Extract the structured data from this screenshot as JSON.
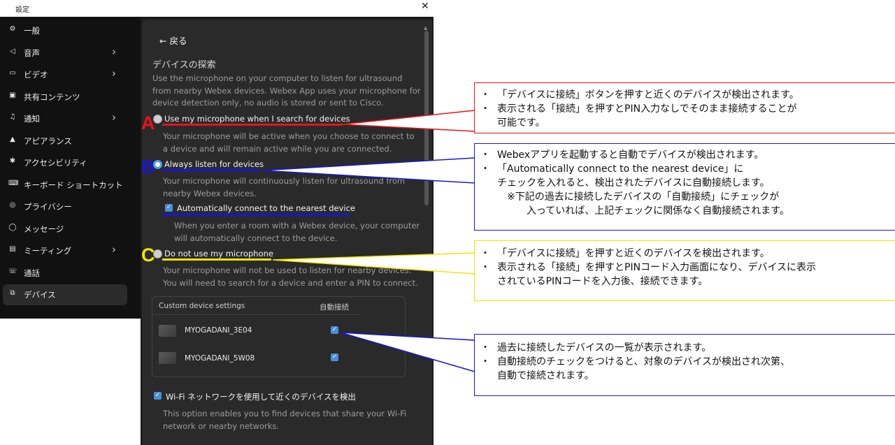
{
  "window": {
    "title": "設定",
    "close_glyph": "✕"
  },
  "sidebar": {
    "items": [
      {
        "label": "一般",
        "icon": "gear-icon",
        "glyph": "⚙",
        "chevron": false,
        "active": false
      },
      {
        "label": "音声",
        "icon": "speaker-icon",
        "glyph": "◁",
        "chevron": true,
        "active": false
      },
      {
        "label": "ビデオ",
        "icon": "video-icon",
        "glyph": "▭",
        "chevron": true,
        "active": false
      },
      {
        "label": "共有コンテンツ",
        "icon": "share-icon",
        "glyph": "▣",
        "chevron": false,
        "active": false
      },
      {
        "label": "通知",
        "icon": "bell-icon",
        "glyph": "♫",
        "chevron": true,
        "active": false
      },
      {
        "label": "アピアランス",
        "icon": "brush-icon",
        "glyph": "▲",
        "chevron": false,
        "active": false
      },
      {
        "label": "アクセシビリティ",
        "icon": "accessibility-icon",
        "glyph": "✱",
        "chevron": false,
        "active": false
      },
      {
        "label": "キーボード ショートカット",
        "icon": "keyboard-icon",
        "glyph": "⌨",
        "chevron": false,
        "active": false
      },
      {
        "label": "プライバシー",
        "icon": "privacy-icon",
        "glyph": "◎",
        "chevron": false,
        "active": false
      },
      {
        "label": "メッセージ",
        "icon": "message-icon",
        "glyph": "◯",
        "chevron": false,
        "active": false
      },
      {
        "label": "ミーティング",
        "icon": "calendar-icon",
        "glyph": "▤",
        "chevron": true,
        "active": false
      },
      {
        "label": "通話",
        "icon": "call-icon",
        "glyph": "☏",
        "chevron": false,
        "active": false
      },
      {
        "label": "デバイス",
        "icon": "device-icon",
        "glyph": "⧉",
        "chevron": false,
        "active": true
      }
    ]
  },
  "main": {
    "back_label": "← 戻る",
    "section_title": "デバイスの探索",
    "intro": [
      "Use the microphone on your computer to listen for ultrasound",
      "from nearby Webex devices. Webex App uses your microphone for",
      "device detection only, no audio is stored or sent to Cisco."
    ],
    "options": [
      {
        "label": "Use my microphone when I search for devices",
        "selected": false,
        "desc": [
          "Your microphone will be active when you choose to connect to",
          "a device and will remain active while you are connected."
        ]
      },
      {
        "label": "Always listen for devices",
        "selected": true,
        "desc": [
          "Your microphone will continuously listen for ultrasound from",
          "nearby Webex devices."
        ],
        "sub_option": {
          "label": "Automatically connect to the nearest device",
          "checked": true,
          "desc": [
            "When you enter a room with a Webex device, your computer",
            "will automatically connect to the device."
          ]
        }
      },
      {
        "label": "Do not use my microphone",
        "selected": false,
        "desc": [
          "Your microphone will not be used to listen for nearby devices.",
          "You will need to search for a device and enter a PIN to connect."
        ]
      }
    ],
    "custom_devices": {
      "header": "Custom device settings",
      "auto_connect_header": "自動接続",
      "devices": [
        {
          "name": "MYOGADANI_3E04",
          "auto_connect": true
        },
        {
          "name": "MYOGADANI_5W08",
          "auto_connect": true
        }
      ]
    },
    "wifi": {
      "label": "Wi-Fi ネットワークを使用して近くのデバイスを検出",
      "checked": true,
      "desc": [
        "This option enables you to find devices that share your Wi-Fi",
        "network or nearby networks."
      ]
    }
  },
  "annotations": {
    "markers": [
      "A",
      "B",
      "C"
    ],
    "colors": {
      "A": "#e8141a",
      "B": "#1a14d6",
      "C": "#f2e400",
      "devices": "#1a14d6"
    },
    "callouts": {
      "A": [
        "「デバイスに接続」ボタンを押すと近くのデバイスが検出されます。",
        "表示される「接続」を押すとPIN入力なしでそのまま接続することが\n可能です。"
      ],
      "B": [
        "Webexアプリを起動すると自動でデバイスが検出されます。",
        "「Automatically connect to the nearest device」に\nチェックを入れると、検出されたデバイスに自動接続します。\n　※下記の過去に接続したデバイスの「自動接続」にチェックが\n　　　入っていれば、上記チェックに関係なく自動接続されます。"
      ],
      "C": [
        "「デバイスに接続」を押すと近くのデバイスを検出されます。",
        "表示される「接続」を押すとPINコード入力画面になり、デバイスに表示\nされているPINコードを入力後、接続できます。"
      ],
      "devices": [
        "過去に接続したデバイスの一覧が表示されます。",
        "自動接続のチェックをつけると、対象のデバイスが検出され次第、\n自動で接続されます。"
      ]
    },
    "bullet": "・"
  }
}
